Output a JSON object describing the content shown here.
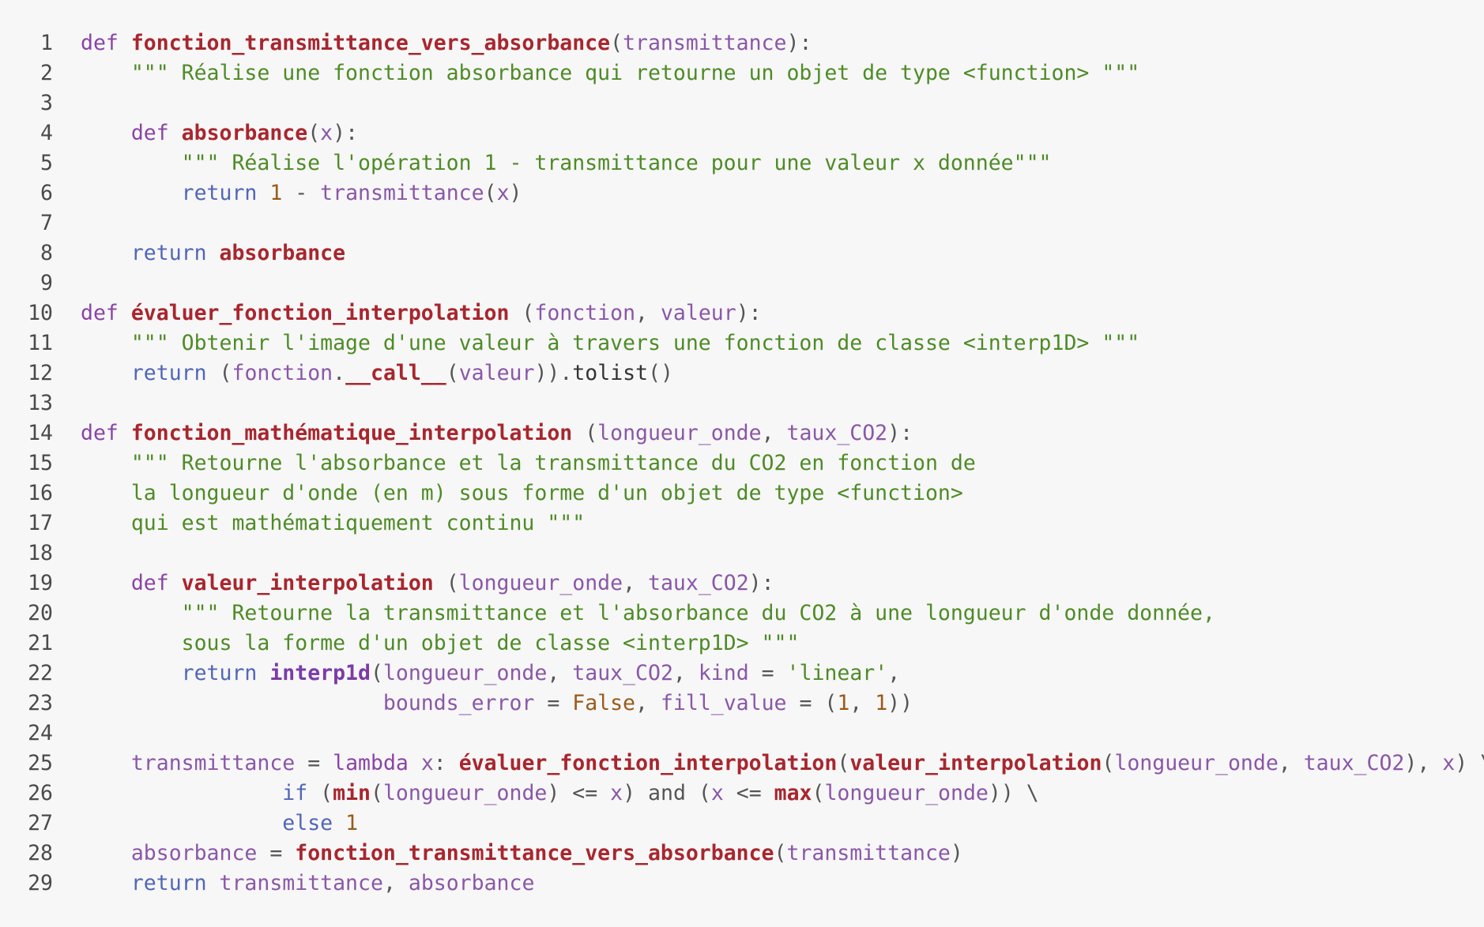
{
  "lines": [
    {
      "n": "1",
      "t": [
        [
          "kw",
          "def "
        ],
        [
          "fn",
          "fonction_transmittance_vers_absorbance"
        ],
        [
          "op",
          "("
        ],
        [
          "id",
          "transmittance"
        ],
        [
          "op",
          "):"
        ]
      ]
    },
    {
      "n": "2",
      "t": [
        [
          "pl",
          "    "
        ],
        [
          "str",
          "\"\"\" Réalise une fonction absorbance qui retourne un objet de type <function> \"\"\""
        ]
      ]
    },
    {
      "n": "3",
      "t": []
    },
    {
      "n": "4",
      "t": [
        [
          "pl",
          "    "
        ],
        [
          "kw",
          "def "
        ],
        [
          "fn",
          "absorbance"
        ],
        [
          "op",
          "("
        ],
        [
          "id",
          "x"
        ],
        [
          "op",
          "):"
        ]
      ]
    },
    {
      "n": "5",
      "t": [
        [
          "pl",
          "        "
        ],
        [
          "str",
          "\"\"\" Réalise l'opération 1 - transmittance pour une valeur x donnée\"\"\""
        ]
      ]
    },
    {
      "n": "6",
      "t": [
        [
          "pl",
          "        "
        ],
        [
          "flow",
          "return "
        ],
        [
          "num",
          "1"
        ],
        [
          "op",
          " - "
        ],
        [
          "id",
          "transmittance"
        ],
        [
          "op",
          "("
        ],
        [
          "id",
          "x"
        ],
        [
          "op",
          ")"
        ]
      ]
    },
    {
      "n": "7",
      "t": []
    },
    {
      "n": "8",
      "t": [
        [
          "pl",
          "    "
        ],
        [
          "flow",
          "return "
        ],
        [
          "fn",
          "absorbance"
        ]
      ]
    },
    {
      "n": "9",
      "t": []
    },
    {
      "n": "10",
      "t": [
        [
          "kw",
          "def "
        ],
        [
          "fn",
          "évaluer_fonction_interpolation"
        ],
        [
          "op",
          " ("
        ],
        [
          "id",
          "fonction"
        ],
        [
          "op",
          ", "
        ],
        [
          "id",
          "valeur"
        ],
        [
          "op",
          "):"
        ]
      ]
    },
    {
      "n": "11",
      "t": [
        [
          "pl",
          "    "
        ],
        [
          "str",
          "\"\"\" Obtenir l'image d'une valeur à travers une fonction de classe <interp1D> \"\"\""
        ]
      ]
    },
    {
      "n": "12",
      "t": [
        [
          "pl",
          "    "
        ],
        [
          "flow",
          "return "
        ],
        [
          "op",
          "("
        ],
        [
          "id",
          "fonction"
        ],
        [
          "op",
          "."
        ],
        [
          "fn",
          "__call__"
        ],
        [
          "op",
          "("
        ],
        [
          "id",
          "valeur"
        ],
        [
          "op",
          ")"
        ],
        [
          "op",
          ")."
        ],
        [
          "pl",
          "tolist"
        ],
        [
          "op",
          "()"
        ]
      ]
    },
    {
      "n": "13",
      "t": []
    },
    {
      "n": "14",
      "t": [
        [
          "kw",
          "def "
        ],
        [
          "fn",
          "fonction_mathématique_interpolation"
        ],
        [
          "op",
          " ("
        ],
        [
          "id",
          "longueur_onde"
        ],
        [
          "op",
          ", "
        ],
        [
          "id",
          "taux_CO2"
        ],
        [
          "op",
          "):"
        ]
      ]
    },
    {
      "n": "15",
      "t": [
        [
          "pl",
          "    "
        ],
        [
          "str",
          "\"\"\" Retourne l'absorbance et la transmittance du CO2 en fonction de"
        ]
      ]
    },
    {
      "n": "16",
      "t": [
        [
          "pl",
          "    "
        ],
        [
          "str",
          "la longueur d'onde (en m) sous forme d'un objet de type <function>"
        ]
      ]
    },
    {
      "n": "17",
      "t": [
        [
          "pl",
          "    "
        ],
        [
          "str",
          "qui est mathématiquement continu \"\"\""
        ]
      ]
    },
    {
      "n": "18",
      "t": []
    },
    {
      "n": "19",
      "t": [
        [
          "pl",
          "    "
        ],
        [
          "kw",
          "def "
        ],
        [
          "fn",
          "valeur_interpolation"
        ],
        [
          "op",
          " ("
        ],
        [
          "id",
          "longueur_onde"
        ],
        [
          "op",
          ", "
        ],
        [
          "id",
          "taux_CO2"
        ],
        [
          "op",
          "):"
        ]
      ]
    },
    {
      "n": "20",
      "t": [
        [
          "pl",
          "        "
        ],
        [
          "str",
          "\"\"\" Retourne la transmittance et l'absorbance du CO2 à une longueur d'onde donnée,"
        ]
      ]
    },
    {
      "n": "21",
      "t": [
        [
          "pl",
          "        "
        ],
        [
          "str",
          "sous la forme d'un objet de classe <interp1D> \"\"\""
        ]
      ]
    },
    {
      "n": "22",
      "t": [
        [
          "pl",
          "        "
        ],
        [
          "flow",
          "return "
        ],
        [
          "cl",
          "interp1d"
        ],
        [
          "op",
          "("
        ],
        [
          "id",
          "longueur_onde"
        ],
        [
          "op",
          ", "
        ],
        [
          "id",
          "taux_CO2"
        ],
        [
          "op",
          ", "
        ],
        [
          "id",
          "kind"
        ],
        [
          "op",
          " = "
        ],
        [
          "str",
          "'linear'"
        ],
        [
          "op",
          ","
        ]
      ]
    },
    {
      "n": "23",
      "t": [
        [
          "pl",
          "                        "
        ],
        [
          "id",
          "bounds_error"
        ],
        [
          "op",
          " = "
        ],
        [
          "num",
          "False"
        ],
        [
          "op",
          ", "
        ],
        [
          "id",
          "fill_value"
        ],
        [
          "op",
          " = ("
        ],
        [
          "num",
          "1"
        ],
        [
          "op",
          ", "
        ],
        [
          "num",
          "1"
        ],
        [
          "op",
          "))"
        ]
      ]
    },
    {
      "n": "24",
      "t": []
    },
    {
      "n": "25",
      "t": [
        [
          "pl",
          "    "
        ],
        [
          "id",
          "transmittance"
        ],
        [
          "op",
          " = "
        ],
        [
          "kw",
          "lambda "
        ],
        [
          "id",
          "x"
        ],
        [
          "op",
          ": "
        ],
        [
          "fn",
          "évaluer_fonction_interpolation"
        ],
        [
          "op",
          "("
        ],
        [
          "fn",
          "valeur_interpolation"
        ],
        [
          "op",
          "("
        ],
        [
          "id",
          "longueur_onde"
        ],
        [
          "op",
          ", "
        ],
        [
          "id",
          "taux_CO2"
        ],
        [
          "op",
          "), "
        ],
        [
          "id",
          "x"
        ],
        [
          "op",
          ") \\"
        ]
      ]
    },
    {
      "n": "26",
      "t": [
        [
          "pl",
          "                "
        ],
        [
          "flow",
          "if "
        ],
        [
          "op",
          "("
        ],
        [
          "fn",
          "min"
        ],
        [
          "op",
          "("
        ],
        [
          "id",
          "longueur_onde"
        ],
        [
          "op",
          ") <= "
        ],
        [
          "id",
          "x"
        ],
        [
          "op",
          ") and ("
        ],
        [
          "id",
          "x"
        ],
        [
          "op",
          " <= "
        ],
        [
          "fn",
          "max"
        ],
        [
          "op",
          "("
        ],
        [
          "id",
          "longueur_onde"
        ],
        [
          "op",
          ")) \\"
        ]
      ]
    },
    {
      "n": "27",
      "t": [
        [
          "pl",
          "                "
        ],
        [
          "flow",
          "else "
        ],
        [
          "num",
          "1"
        ]
      ]
    },
    {
      "n": "28",
      "t": [
        [
          "pl",
          "    "
        ],
        [
          "id",
          "absorbance"
        ],
        [
          "op",
          " = "
        ],
        [
          "fn",
          "fonction_transmittance_vers_absorbance"
        ],
        [
          "op",
          "("
        ],
        [
          "id",
          "transmittance"
        ],
        [
          "op",
          ")"
        ]
      ]
    },
    {
      "n": "29",
      "t": [
        [
          "pl",
          "    "
        ],
        [
          "flow",
          "return "
        ],
        [
          "id",
          "transmittance"
        ],
        [
          "op",
          ", "
        ],
        [
          "id",
          "absorbance"
        ]
      ]
    }
  ]
}
